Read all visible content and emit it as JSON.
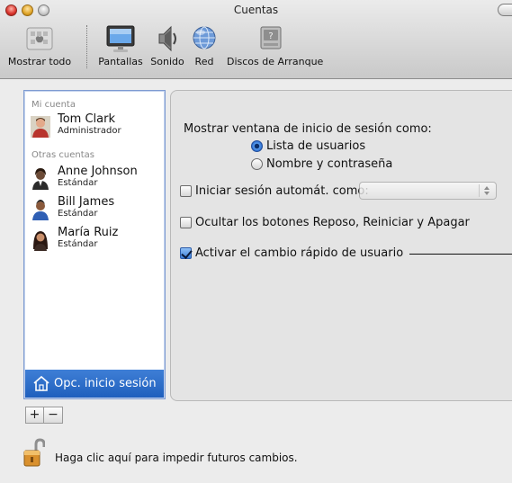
{
  "window": {
    "title": "Cuentas"
  },
  "toolbar": {
    "items": [
      {
        "label": "Mostrar todo",
        "icon": "show-all-icon"
      },
      {
        "label": "Pantallas",
        "icon": "displays-icon"
      },
      {
        "label": "Sonido",
        "icon": "sound-icon"
      },
      {
        "label": "Red",
        "icon": "network-icon"
      },
      {
        "label": "Discos de Arranque",
        "icon": "startup-disk-icon"
      }
    ]
  },
  "sidebar": {
    "my_account_label": "Mi cuenta",
    "my_account": {
      "name": "Tom Clark",
      "role": "Administrador"
    },
    "other_accounts_label": "Otras cuentas",
    "other_accounts": [
      {
        "name": "Anne Johnson",
        "role": "Estándar"
      },
      {
        "name": "Bill James",
        "role": "Estándar"
      },
      {
        "name": "María Ruiz",
        "role": "Estándar"
      }
    ],
    "login_options_label": "Opc. inicio sesión"
  },
  "panel": {
    "display_login_as": "Mostrar ventana de inicio de sesión como:",
    "radio_list_label": "Lista de usuarios",
    "radio_name_label": "Nombre y contraseña",
    "radio_selected": "Lista de usuarios",
    "auto_login_label": "Iniciar sesión automát. como:",
    "auto_login_checked": false,
    "auto_login_value": "",
    "hide_buttons_label": "Ocultar los botones Reposo, Reiniciar y Apagar",
    "hide_buttons_checked": false,
    "fast_switch_label": "Activar el cambio rápido de usuario",
    "fast_switch_checked": true
  },
  "footer": {
    "add_label": "+",
    "remove_label": "−",
    "lock_text": "Haga clic aquí para impedir futuros cambios."
  },
  "colors": {
    "selection": "#2a68c9",
    "chrome_top": "#ebebeb",
    "chrome_bottom": "#c9c9c9"
  }
}
